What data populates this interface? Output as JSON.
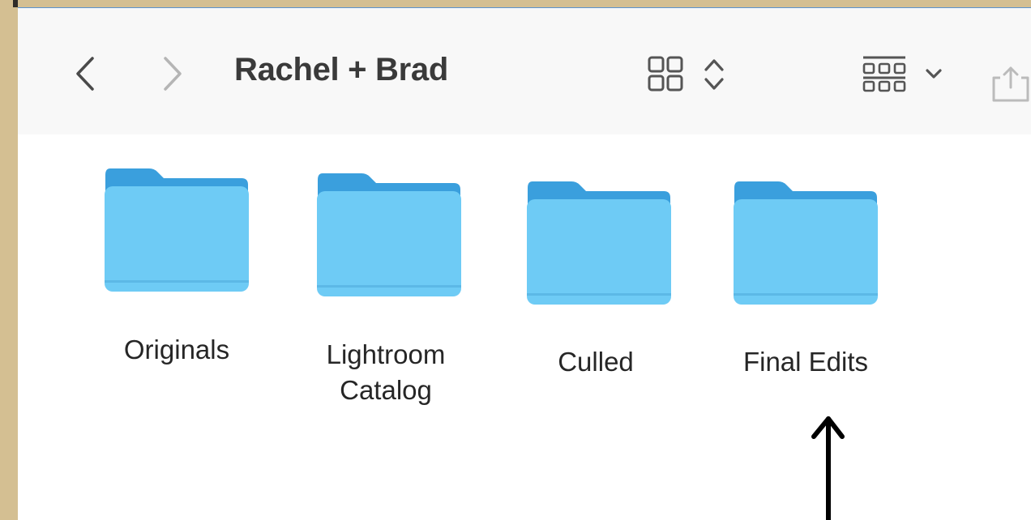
{
  "finder": {
    "title": "Rachel + Brad",
    "toolbar": {
      "back_icon": "chevron-left-icon",
      "forward_icon": "chevron-right-icon",
      "view_icon": "grid-view-icon",
      "view_toggle_icon": "up-down-chevron-icon",
      "group_icon": "group-by-icon",
      "group_menu_icon": "chevron-down-icon",
      "share_icon": "share-icon"
    },
    "folders": [
      {
        "label": "Originals"
      },
      {
        "label": "Lightroom Catalog",
        "label_line1": "Lightroom",
        "label_line2": "Catalog"
      },
      {
        "label": "Culled"
      },
      {
        "label": "Final Edits"
      }
    ],
    "colors": {
      "folder_body": "#6ecbf5",
      "folder_tab": "#3a9fdd",
      "frame": "#d4bf92",
      "annotation_arrow": "#000000"
    }
  }
}
